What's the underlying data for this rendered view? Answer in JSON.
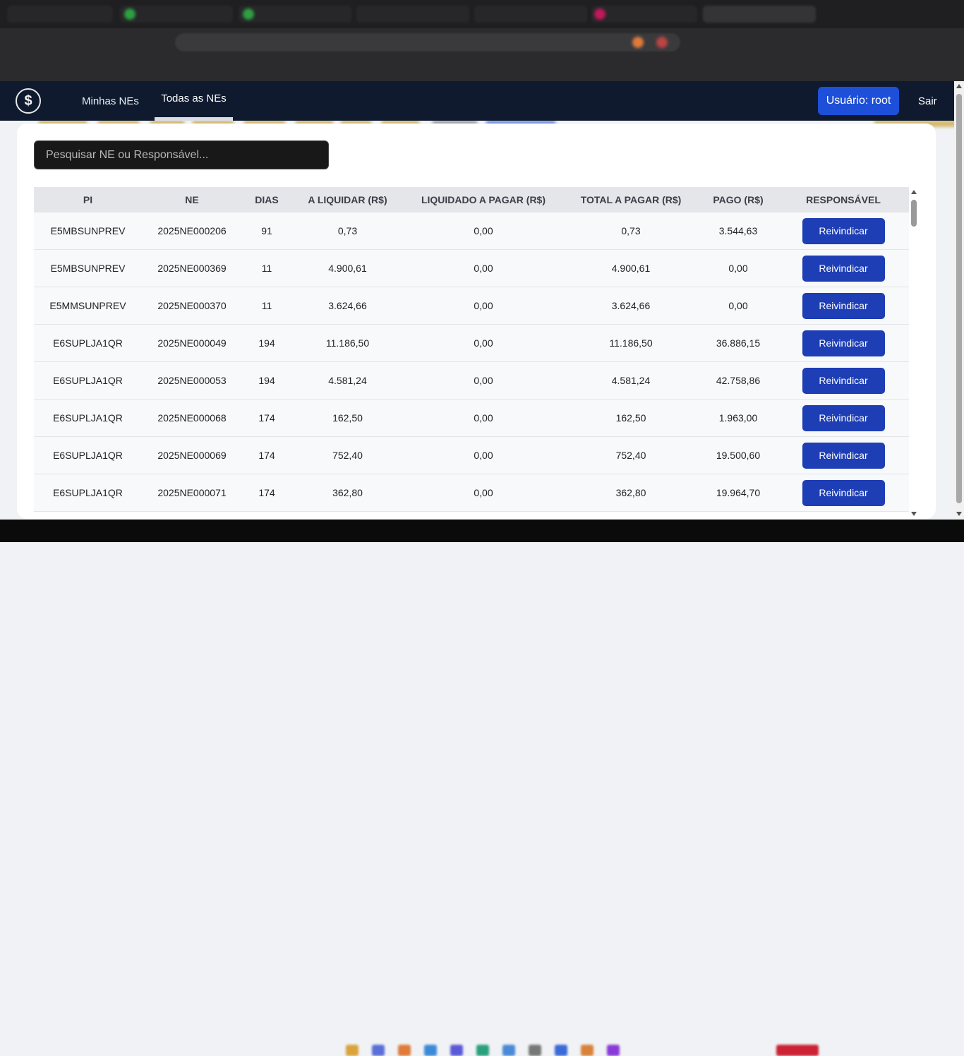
{
  "nav": {
    "tab_minhas": "Minhas NEs",
    "tab_todas": "Todas as NEs",
    "user_label": "Usuário: root",
    "logout": "Sair"
  },
  "search": {
    "placeholder": "Pesquisar NE ou Responsável..."
  },
  "table": {
    "headers": [
      "PI",
      "NE",
      "DIAS",
      "A LIQUIDAR (R$)",
      "LIQUIDADO A PAGAR (R$)",
      "TOTAL A PAGAR (R$)",
      "PAGO (R$)",
      "RESPONSÁVEL"
    ],
    "rows": [
      {
        "pi": "E5MBSUNPREV",
        "ne": "2025NE000206",
        "dias": "91",
        "a_liquidar": "0,73",
        "liquidado": "0,00",
        "total": "0,73",
        "pago": "3.544,63",
        "action": "Reivindicar"
      },
      {
        "pi": "E5MBSUNPREV",
        "ne": "2025NE000369",
        "dias": "11",
        "a_liquidar": "4.900,61",
        "liquidado": "0,00",
        "total": "4.900,61",
        "pago": "0,00",
        "action": "Reivindicar"
      },
      {
        "pi": "E5MMSUNPREV",
        "ne": "2025NE000370",
        "dias": "11",
        "a_liquidar": "3.624,66",
        "liquidado": "0,00",
        "total": "3.624,66",
        "pago": "0,00",
        "action": "Reivindicar"
      },
      {
        "pi": "E6SUPLJA1QR",
        "ne": "2025NE000049",
        "dias": "194",
        "a_liquidar": "11.186,50",
        "liquidado": "0,00",
        "total": "11.186,50",
        "pago": "36.886,15",
        "action": "Reivindicar"
      },
      {
        "pi": "E6SUPLJA1QR",
        "ne": "2025NE000053",
        "dias": "194",
        "a_liquidar": "4.581,24",
        "liquidado": "0,00",
        "total": "4.581,24",
        "pago": "42.758,86",
        "action": "Reivindicar"
      },
      {
        "pi": "E6SUPLJA1QR",
        "ne": "2025NE000068",
        "dias": "174",
        "a_liquidar": "162,50",
        "liquidado": "0,00",
        "total": "162,50",
        "pago": "1.963,00",
        "action": "Reivindicar"
      },
      {
        "pi": "E6SUPLJA1QR",
        "ne": "2025NE000069",
        "dias": "174",
        "a_liquidar": "752,40",
        "liquidado": "0,00",
        "total": "752,40",
        "pago": "19.500,60",
        "action": "Reivindicar"
      },
      {
        "pi": "E6SUPLJA1QR",
        "ne": "2025NE000071",
        "dias": "174",
        "a_liquidar": "362,80",
        "liquidado": "0,00",
        "total": "362,80",
        "pago": "19.964,70",
        "action": "Reivindicar"
      }
    ]
  },
  "colors": {
    "navbar": "#0f1a2e",
    "primary_button": "#1d4fd8",
    "claim_button": "#1e3eb5"
  },
  "icons": {
    "logo": "dollar-sign-logo-icon"
  }
}
